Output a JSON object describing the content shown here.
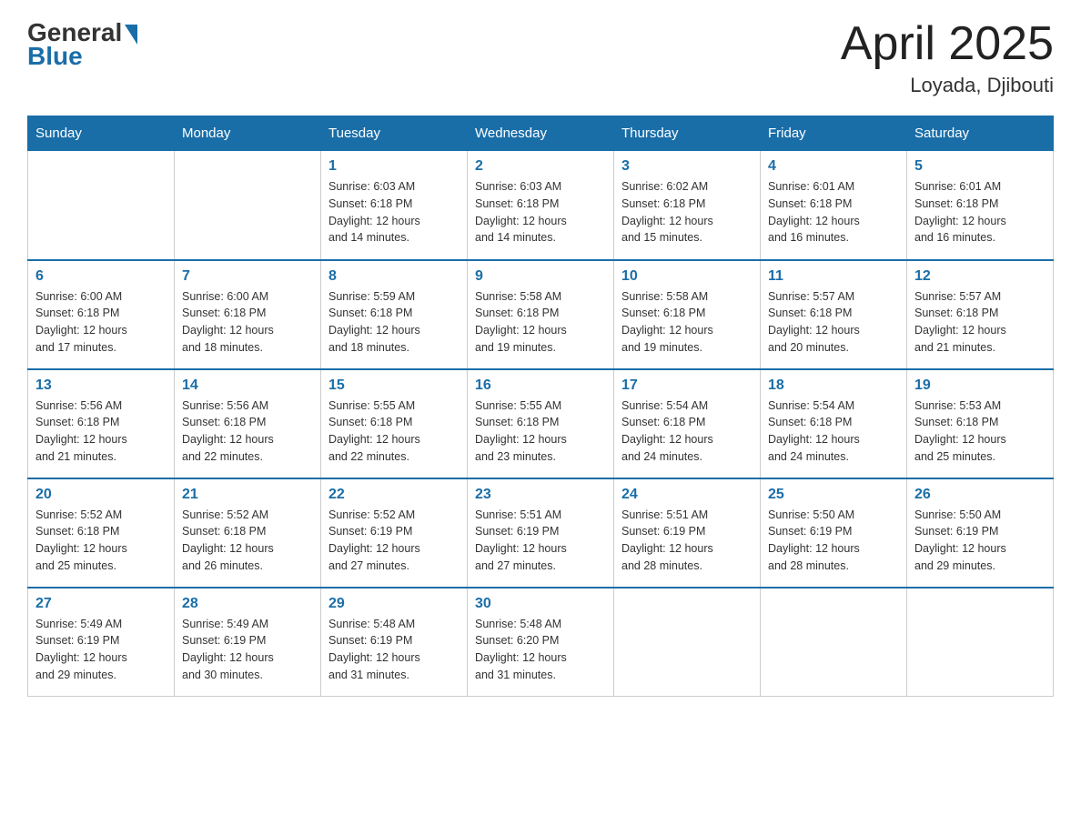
{
  "header": {
    "logo_general": "General",
    "logo_blue": "Blue",
    "month_title": "April 2025",
    "location": "Loyada, Djibouti"
  },
  "days_of_week": [
    "Sunday",
    "Monday",
    "Tuesday",
    "Wednesday",
    "Thursday",
    "Friday",
    "Saturday"
  ],
  "weeks": [
    [
      {
        "day": "",
        "info": ""
      },
      {
        "day": "",
        "info": ""
      },
      {
        "day": "1",
        "info": "Sunrise: 6:03 AM\nSunset: 6:18 PM\nDaylight: 12 hours\nand 14 minutes."
      },
      {
        "day": "2",
        "info": "Sunrise: 6:03 AM\nSunset: 6:18 PM\nDaylight: 12 hours\nand 14 minutes."
      },
      {
        "day": "3",
        "info": "Sunrise: 6:02 AM\nSunset: 6:18 PM\nDaylight: 12 hours\nand 15 minutes."
      },
      {
        "day": "4",
        "info": "Sunrise: 6:01 AM\nSunset: 6:18 PM\nDaylight: 12 hours\nand 16 minutes."
      },
      {
        "day": "5",
        "info": "Sunrise: 6:01 AM\nSunset: 6:18 PM\nDaylight: 12 hours\nand 16 minutes."
      }
    ],
    [
      {
        "day": "6",
        "info": "Sunrise: 6:00 AM\nSunset: 6:18 PM\nDaylight: 12 hours\nand 17 minutes."
      },
      {
        "day": "7",
        "info": "Sunrise: 6:00 AM\nSunset: 6:18 PM\nDaylight: 12 hours\nand 18 minutes."
      },
      {
        "day": "8",
        "info": "Sunrise: 5:59 AM\nSunset: 6:18 PM\nDaylight: 12 hours\nand 18 minutes."
      },
      {
        "day": "9",
        "info": "Sunrise: 5:58 AM\nSunset: 6:18 PM\nDaylight: 12 hours\nand 19 minutes."
      },
      {
        "day": "10",
        "info": "Sunrise: 5:58 AM\nSunset: 6:18 PM\nDaylight: 12 hours\nand 19 minutes."
      },
      {
        "day": "11",
        "info": "Sunrise: 5:57 AM\nSunset: 6:18 PM\nDaylight: 12 hours\nand 20 minutes."
      },
      {
        "day": "12",
        "info": "Sunrise: 5:57 AM\nSunset: 6:18 PM\nDaylight: 12 hours\nand 21 minutes."
      }
    ],
    [
      {
        "day": "13",
        "info": "Sunrise: 5:56 AM\nSunset: 6:18 PM\nDaylight: 12 hours\nand 21 minutes."
      },
      {
        "day": "14",
        "info": "Sunrise: 5:56 AM\nSunset: 6:18 PM\nDaylight: 12 hours\nand 22 minutes."
      },
      {
        "day": "15",
        "info": "Sunrise: 5:55 AM\nSunset: 6:18 PM\nDaylight: 12 hours\nand 22 minutes."
      },
      {
        "day": "16",
        "info": "Sunrise: 5:55 AM\nSunset: 6:18 PM\nDaylight: 12 hours\nand 23 minutes."
      },
      {
        "day": "17",
        "info": "Sunrise: 5:54 AM\nSunset: 6:18 PM\nDaylight: 12 hours\nand 24 minutes."
      },
      {
        "day": "18",
        "info": "Sunrise: 5:54 AM\nSunset: 6:18 PM\nDaylight: 12 hours\nand 24 minutes."
      },
      {
        "day": "19",
        "info": "Sunrise: 5:53 AM\nSunset: 6:18 PM\nDaylight: 12 hours\nand 25 minutes."
      }
    ],
    [
      {
        "day": "20",
        "info": "Sunrise: 5:52 AM\nSunset: 6:18 PM\nDaylight: 12 hours\nand 25 minutes."
      },
      {
        "day": "21",
        "info": "Sunrise: 5:52 AM\nSunset: 6:18 PM\nDaylight: 12 hours\nand 26 minutes."
      },
      {
        "day": "22",
        "info": "Sunrise: 5:52 AM\nSunset: 6:19 PM\nDaylight: 12 hours\nand 27 minutes."
      },
      {
        "day": "23",
        "info": "Sunrise: 5:51 AM\nSunset: 6:19 PM\nDaylight: 12 hours\nand 27 minutes."
      },
      {
        "day": "24",
        "info": "Sunrise: 5:51 AM\nSunset: 6:19 PM\nDaylight: 12 hours\nand 28 minutes."
      },
      {
        "day": "25",
        "info": "Sunrise: 5:50 AM\nSunset: 6:19 PM\nDaylight: 12 hours\nand 28 minutes."
      },
      {
        "day": "26",
        "info": "Sunrise: 5:50 AM\nSunset: 6:19 PM\nDaylight: 12 hours\nand 29 minutes."
      }
    ],
    [
      {
        "day": "27",
        "info": "Sunrise: 5:49 AM\nSunset: 6:19 PM\nDaylight: 12 hours\nand 29 minutes."
      },
      {
        "day": "28",
        "info": "Sunrise: 5:49 AM\nSunset: 6:19 PM\nDaylight: 12 hours\nand 30 minutes."
      },
      {
        "day": "29",
        "info": "Sunrise: 5:48 AM\nSunset: 6:19 PM\nDaylight: 12 hours\nand 31 minutes."
      },
      {
        "day": "30",
        "info": "Sunrise: 5:48 AM\nSunset: 6:20 PM\nDaylight: 12 hours\nand 31 minutes."
      },
      {
        "day": "",
        "info": ""
      },
      {
        "day": "",
        "info": ""
      },
      {
        "day": "",
        "info": ""
      }
    ]
  ]
}
